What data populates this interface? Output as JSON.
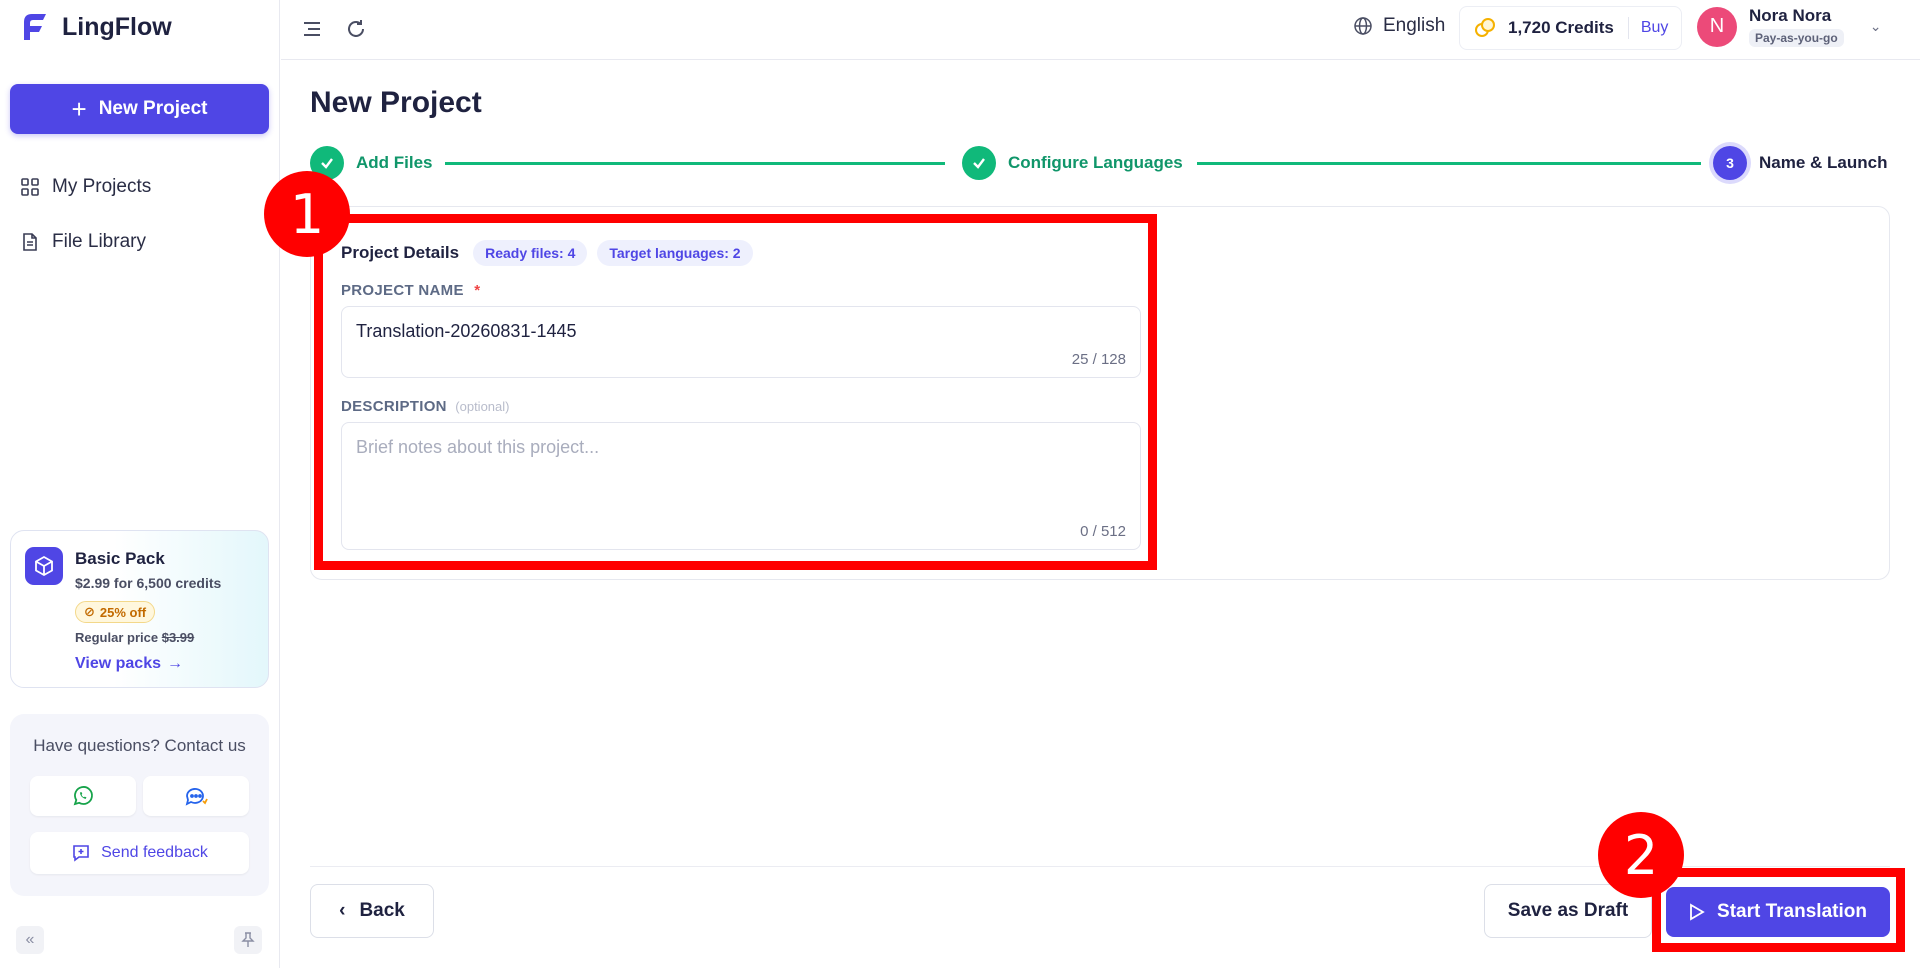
{
  "app": {
    "name": "LingFlow"
  },
  "sidebar": {
    "new_project_label": "New Project",
    "items": [
      {
        "label": "My Projects",
        "icon": "grid-icon"
      },
      {
        "label": "File Library",
        "icon": "document-icon"
      }
    ],
    "promo": {
      "title": "Basic Pack",
      "price": "$2.99 for 6,500 credits",
      "badge": "25% off",
      "regular_label": "Regular price",
      "regular_price": "$3.99",
      "link": "View packs"
    },
    "help": {
      "title": "Have questions? Contact us",
      "feedback_label": "Send feedback"
    }
  },
  "topbar": {
    "language": "English",
    "credits": "1,720 Credits",
    "buy_label": "Buy",
    "user": {
      "initial": "N",
      "name": "Nora Nora",
      "plan": "Pay-as-you-go"
    }
  },
  "page": {
    "title": "New Project",
    "steps": [
      {
        "label": "Add Files",
        "state": "done"
      },
      {
        "label": "Configure Languages",
        "state": "done"
      },
      {
        "number": "3",
        "label": "Name & Launch",
        "state": "current"
      }
    ]
  },
  "form": {
    "title": "Project Details",
    "chips": [
      "Ready files: 4",
      "Target languages: 2"
    ],
    "name": {
      "label": "PROJECT NAME",
      "required_mark": "*",
      "value": "Translation-20260831-1445",
      "counter": "25 / 128"
    },
    "description": {
      "label": "DESCRIPTION",
      "optional_note": "(optional)",
      "placeholder": "Brief notes about this project...",
      "counter": "0 / 512"
    }
  },
  "actions": {
    "back_label": "Back",
    "draft_label": "Save as Draft",
    "start_label": "Start Translation"
  },
  "annotations": [
    "1",
    "2"
  ],
  "colors": {
    "accent": "#4f46e5",
    "success": "#10b97a",
    "annotation": "#ff0000"
  }
}
